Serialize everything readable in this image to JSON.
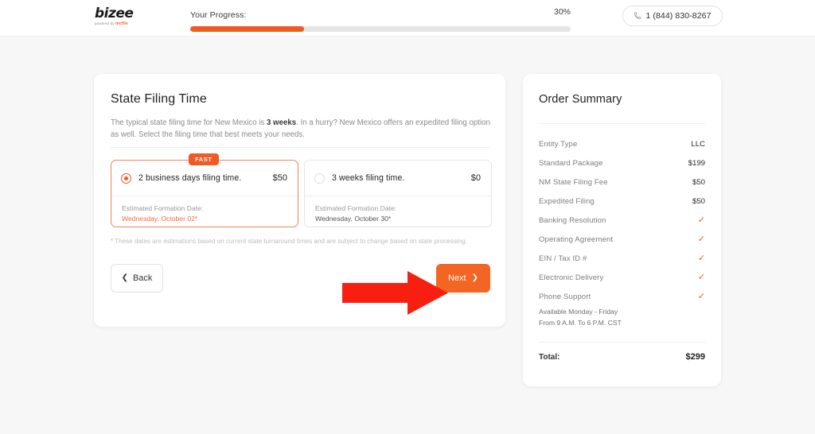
{
  "header": {
    "logo_word": "bizee",
    "logo_sub_prefix": "powered by ",
    "logo_sub_brand": "incfile",
    "progress_label": "Your Progress:",
    "progress_pct_text": "30%",
    "progress_pct": 30,
    "phone": "1 (844) 830-8267",
    "phone_icon": "phone-icon"
  },
  "main": {
    "title": "State Filing Time",
    "desc_part1": "The typical state filing time for New Mexico is ",
    "desc_bold": "3 weeks",
    "desc_part2": ". In a hurry? New Mexico offers an expedited filing option as well. Select the filing time that best meets your needs.",
    "options": [
      {
        "badge": "FAST",
        "label": "2 business days filing time.",
        "price": "$50",
        "date_label": "Estimated Formation Date:",
        "date_value": "Wednesday, October 02*",
        "selected": true
      },
      {
        "badge": "",
        "label": "3 weeks filing time.",
        "price": "$0",
        "date_label": "Estimated Formation Date:",
        "date_value": "Wednesday, October 30*",
        "selected": false
      }
    ],
    "footnote": "* These dates are estimations based on current state turnaround times and are subject to change based on state processing.",
    "back_label": "Back",
    "next_label": "Next",
    "back_chevron": "chevron-left-icon",
    "next_chevron": "chevron-right-icon"
  },
  "summary": {
    "title": "Order Summary",
    "rows": [
      {
        "label": "Entity Type",
        "value": "LLC",
        "type": "text"
      },
      {
        "label": "Standard Package",
        "value": "$199",
        "type": "text"
      },
      {
        "label": "NM State Filing Fee",
        "value": "$50",
        "type": "text"
      },
      {
        "label": "Expedited Filing",
        "value": "$50",
        "type": "text"
      },
      {
        "label": "Banking Resolution",
        "value": "✓",
        "type": "check"
      },
      {
        "label": "Operating Agreement",
        "value": "✓",
        "type": "check"
      },
      {
        "label": "EIN / Tax ID #",
        "value": "✓",
        "type": "check"
      },
      {
        "label": "Electronic Delivery",
        "value": "✓",
        "type": "check"
      },
      {
        "label": "Phone Support",
        "value": "✓",
        "type": "check"
      }
    ],
    "note_line1": "Available Monday - Friday",
    "note_line2": "From 9 A.M. To 6 P.M. CST",
    "total_label": "Total:",
    "total_value": "$299"
  },
  "annotation": {
    "arrow": "red-arrow-pointing-to-next-button",
    "color": "#f81f10"
  },
  "colors": {
    "accent": "#ef5a21",
    "next_button": "#f26522",
    "check": "#f2553d",
    "page_bg": "#f7f7f7"
  }
}
